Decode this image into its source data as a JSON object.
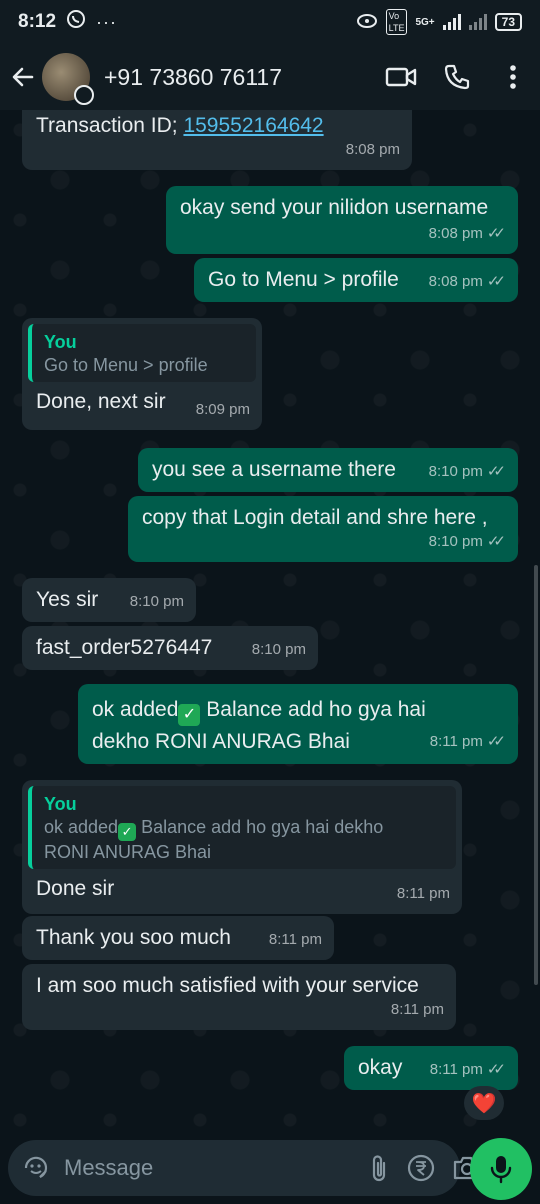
{
  "status_bar": {
    "time": "8:12",
    "network": "5G+",
    "battery": "73"
  },
  "header": {
    "contact_name": "+91 73860 76117"
  },
  "messages": [
    {
      "dir": "in",
      "text": "Transaction ID; ",
      "link": "159552164642",
      "time": "8:08 pm"
    },
    {
      "dir": "out",
      "text": "okay send your nilidon username",
      "time": "8:08 pm"
    },
    {
      "dir": "out",
      "text": "Go to Menu > profile",
      "time": "8:08 pm"
    },
    {
      "dir": "in",
      "quote_author": "You",
      "quote_text": "Go to Menu > profile",
      "text": "Done, next sir",
      "time": "8:09 pm"
    },
    {
      "dir": "out",
      "text": "you see a username there",
      "time": "8:10 pm"
    },
    {
      "dir": "out",
      "text": "copy that Login detail and shre here ,",
      "time": "8:10 pm"
    },
    {
      "dir": "in",
      "text": "Yes sir",
      "time": "8:10 pm"
    },
    {
      "dir": "in",
      "text": "fast_order5276447",
      "time": "8:10 pm"
    },
    {
      "dir": "out",
      "text_a": "ok added",
      "text_b": " Balance add ho gya hai",
      "text_c": "dekho RONI ANURAG Bhai",
      "time": "8:11 pm"
    },
    {
      "dir": "in",
      "quote_author": "You",
      "quote_text_a": "ok added",
      "quote_text_b": " Balance add ho gya hai dekho",
      "quote_text_c": "RONI ANURAG Bhai",
      "text": "Done sir",
      "time": "8:11 pm"
    },
    {
      "dir": "in",
      "text": "Thank you soo much",
      "time": "8:11 pm"
    },
    {
      "dir": "in",
      "text": "I am soo much satisfied with your service",
      "time": "8:11 pm"
    },
    {
      "dir": "out",
      "text": "okay",
      "time": "8:11 pm",
      "reaction": "❤️"
    }
  ],
  "input": {
    "placeholder": "Message"
  },
  "icons": {
    "back": "arrow-left-icon",
    "video": "video-call-icon",
    "call": "phone-icon",
    "menu": "more-vert-icon",
    "sticker": "sticker-icon",
    "attach": "paperclip-icon",
    "payment": "rupee-icon",
    "camera": "camera-icon",
    "mic": "mic-icon"
  },
  "colors": {
    "outgoing_bubble": "#005c4b",
    "incoming_bubble": "#202c33",
    "accent": "#21c063",
    "link": "#53bdeb"
  }
}
